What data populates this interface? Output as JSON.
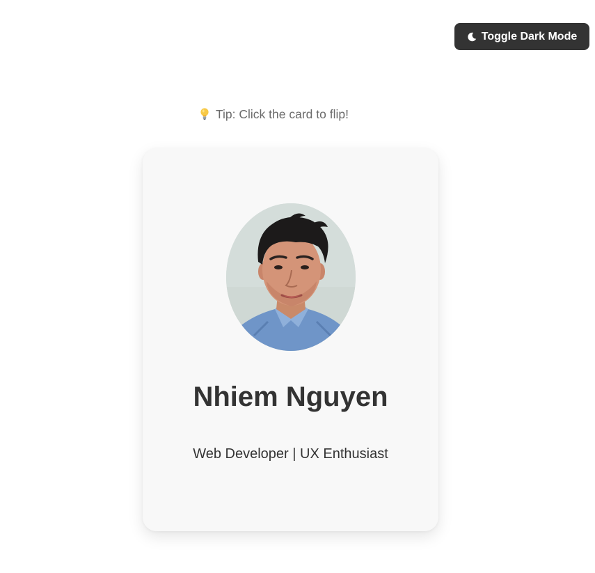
{
  "toolbar": {
    "toggle_label": "Toggle Dark Mode",
    "toggle_icon": "moon-icon"
  },
  "tip": {
    "icon": "lightbulb-icon",
    "text": "Tip: Click the card to flip!"
  },
  "card": {
    "name": "Nhiem Nguyen",
    "role": "Web Developer | UX Enthusiast",
    "avatar_icon": "profile-photo"
  },
  "colors": {
    "button_bg": "#333333",
    "button_text": "#ffffff",
    "card_bg": "#f8f8f8",
    "name_text": "#333333",
    "tip_text": "#6b6b6b",
    "page_bg": "#ffffff"
  }
}
